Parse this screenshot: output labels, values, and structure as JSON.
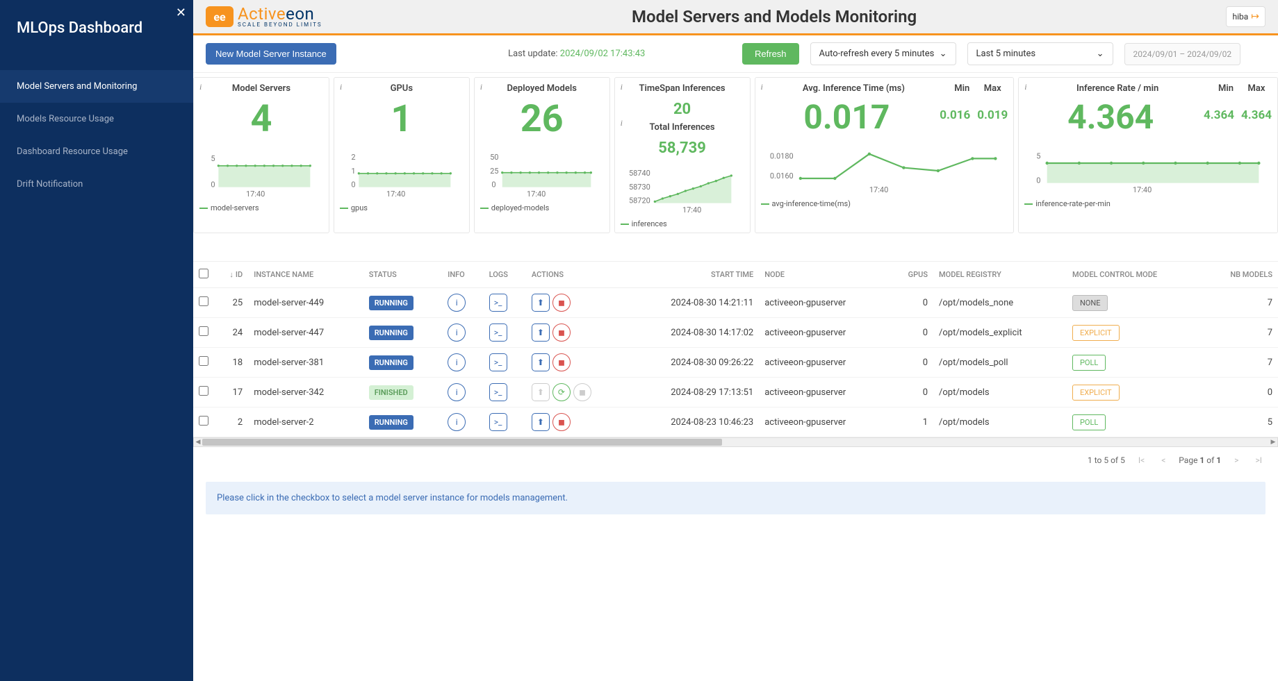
{
  "sidebar": {
    "title": "MLOps Dashboard",
    "items": [
      {
        "label": "Model Servers and Monitoring",
        "active": true
      },
      {
        "label": "Models Resource Usage",
        "active": false
      },
      {
        "label": "Dashboard Resource Usage",
        "active": false
      },
      {
        "label": "Drift Notification",
        "active": false
      }
    ]
  },
  "header": {
    "brand_a": "Active",
    "brand_b": "eon",
    "tagline": "SCALE BEYOND LIMITS",
    "page_title": "Model Servers and Models Monitoring",
    "user": "hiba"
  },
  "toolbar": {
    "new_instance": "New Model Server Instance",
    "last_update_label": "Last update:",
    "last_update_value": "2024/09/02 17:43:43",
    "refresh": "Refresh",
    "auto_refresh": "Auto-refresh every 5 minutes",
    "timerange": "Last 5 minutes",
    "daterange": "2024/09/01 – 2024/09/02"
  },
  "cards": {
    "model_servers": {
      "title": "Model Servers",
      "value": "4",
      "legend": "model-servers",
      "tick": "17:40",
      "y": [
        "5",
        "0"
      ]
    },
    "gpus": {
      "title": "GPUs",
      "value": "1",
      "legend": "gpus",
      "tick": "17:40",
      "y": [
        "2",
        "1",
        "0"
      ]
    },
    "deployed_models": {
      "title": "Deployed Models",
      "value": "26",
      "legend": "deployed-models",
      "tick": "17:40",
      "y": [
        "50",
        "25",
        "0"
      ]
    },
    "inferences": {
      "title_top": "TimeSpan Inferences",
      "value_top": "20",
      "title_bottom": "Total Inferences",
      "value_bottom": "58,739",
      "legend": "inferences",
      "tick": "17:40",
      "y": [
        "58740",
        "58730",
        "58720"
      ]
    },
    "avg_inf": {
      "title": "Avg. Inference Time (ms)",
      "min_label": "Min",
      "max_label": "Max",
      "value": "0.017",
      "min": "0.016",
      "max": "0.019",
      "legend": "avg-inference-time(ms)",
      "tick": "17:40",
      "y": [
        "0.0180",
        "0.0160"
      ]
    },
    "inf_rate": {
      "title": "Inference Rate / min",
      "min_label": "Min",
      "max_label": "Max",
      "value": "4.364",
      "min": "4.364",
      "max": "4.364",
      "legend": "inference-rate-per-min",
      "tick": "17:40",
      "y": [
        "5",
        "0"
      ]
    }
  },
  "table": {
    "headers": {
      "id": "ID",
      "instance": "INSTANCE NAME",
      "status": "STATUS",
      "info": "INFO",
      "logs": "LOGS",
      "actions": "ACTIONS",
      "start": "START TIME",
      "node": "NODE",
      "gpus": "GPUS",
      "registry": "MODEL REGISTRY",
      "mode": "MODEL CONTROL MODE",
      "nbmodels": "NB MODELS"
    },
    "rows": [
      {
        "id": "25",
        "name": "model-server-449",
        "status": "RUNNING",
        "status_class": "running",
        "start": "2024-08-30 14:21:11",
        "node": "activeeon-gpuserver",
        "gpus": "0",
        "registry": "/opt/models_none",
        "mode": "NONE",
        "mode_class": "none",
        "nb": "7",
        "disabled": false
      },
      {
        "id": "24",
        "name": "model-server-447",
        "status": "RUNNING",
        "status_class": "running",
        "start": "2024-08-30 14:17:02",
        "node": "activeeon-gpuserver",
        "gpus": "0",
        "registry": "/opt/models_explicit",
        "mode": "EXPLICIT",
        "mode_class": "explicit",
        "nb": "7",
        "disabled": false
      },
      {
        "id": "18",
        "name": "model-server-381",
        "status": "RUNNING",
        "status_class": "running",
        "start": "2024-08-30 09:26:22",
        "node": "activeeon-gpuserver",
        "gpus": "0",
        "registry": "/opt/models_poll",
        "mode": "POLL",
        "mode_class": "poll",
        "nb": "7",
        "disabled": false
      },
      {
        "id": "17",
        "name": "model-server-342",
        "status": "FINISHED",
        "status_class": "finished",
        "start": "2024-08-29 17:13:51",
        "node": "activeeon-gpuserver",
        "gpus": "0",
        "registry": "/opt/models",
        "mode": "EXPLICIT",
        "mode_class": "explicit",
        "nb": "0",
        "disabled": true
      },
      {
        "id": "2",
        "name": "model-server-2",
        "status": "RUNNING",
        "status_class": "running",
        "start": "2024-08-23 10:46:23",
        "node": "activeeon-gpuserver",
        "gpus": "1",
        "registry": "/opt/models",
        "mode": "POLL",
        "mode_class": "poll",
        "nb": "5",
        "disabled": false
      }
    ]
  },
  "pager": {
    "range": "1 to 5 of 5",
    "page": "Page 1 of 1"
  },
  "hint": "Please click in the checkbox to select a model server instance for models management.",
  "chart_data": [
    {
      "type": "line",
      "title": "model-servers",
      "x_tick": "17:40",
      "y": [
        4,
        4,
        4,
        4,
        4,
        4,
        4,
        4,
        4,
        4
      ],
      "ylim": [
        0,
        5
      ]
    },
    {
      "type": "line",
      "title": "gpus",
      "x_tick": "17:40",
      "y": [
        1,
        1,
        1,
        1,
        1,
        1,
        1,
        1,
        1,
        1
      ],
      "ylim": [
        0,
        2
      ]
    },
    {
      "type": "line",
      "title": "deployed-models",
      "x_tick": "17:40",
      "y": [
        26,
        26,
        26,
        26,
        26,
        26,
        26,
        26,
        26,
        26
      ],
      "ylim": [
        0,
        50
      ]
    },
    {
      "type": "line",
      "title": "inferences",
      "x_tick": "17:40",
      "y": [
        58720,
        58722,
        58724,
        58726,
        58728,
        58730,
        58732,
        58734,
        58737,
        58739
      ],
      "ylim": [
        58720,
        58740
      ]
    },
    {
      "type": "line",
      "title": "avg-inference-time(ms)",
      "x_tick": "17:40",
      "y": [
        0.016,
        0.016,
        0.019,
        0.017,
        0.0165,
        0.018,
        0.018
      ],
      "ylim": [
        0.016,
        0.019
      ]
    },
    {
      "type": "line",
      "title": "inference-rate-per-min",
      "x_tick": "17:40",
      "y": [
        4.364,
        4.364,
        4.364,
        4.364,
        4.364,
        4.364,
        4.364
      ],
      "ylim": [
        0,
        5
      ]
    }
  ]
}
